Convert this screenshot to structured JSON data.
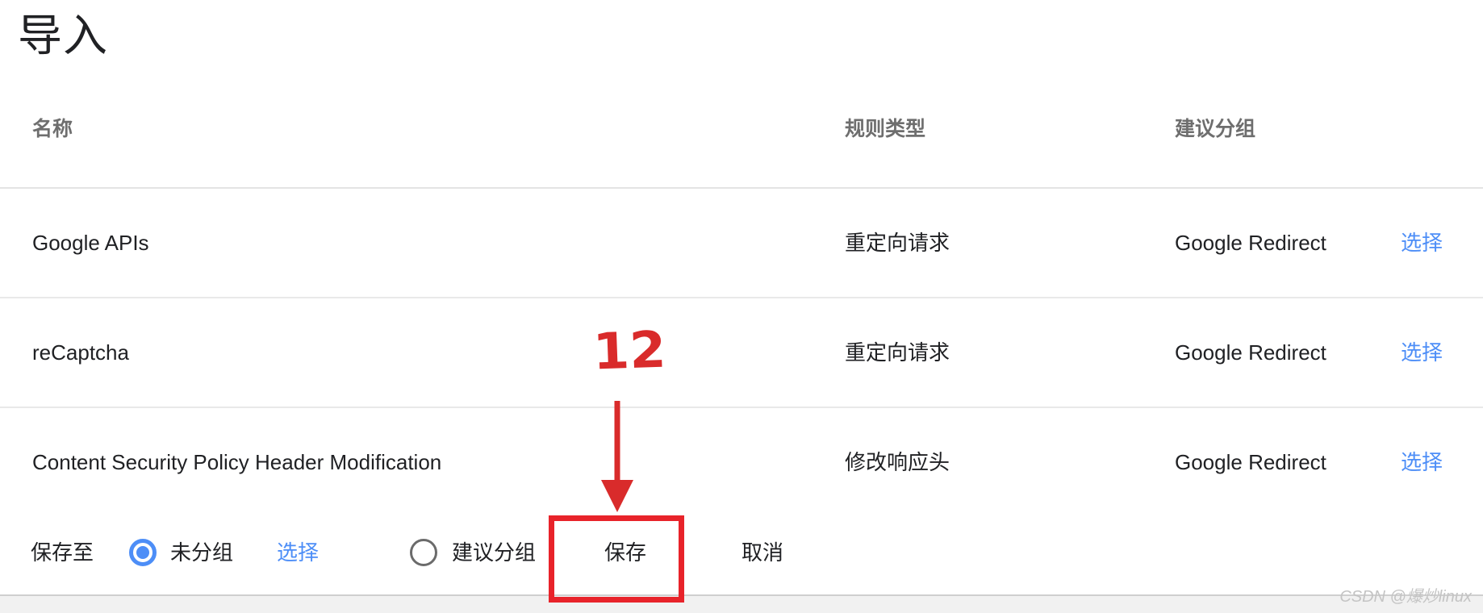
{
  "page": {
    "title": "导入"
  },
  "table": {
    "columns": {
      "name": "名称",
      "rule_type": "规则类型",
      "suggested_group": "建议分组"
    },
    "action_label": "选择",
    "rows": [
      {
        "name": "Google APIs",
        "rule_type": "重定向请求",
        "suggested_group": "Google Redirect",
        "action": "选择"
      },
      {
        "name": "reCaptcha",
        "rule_type": "重定向请求",
        "suggested_group": "Google Redirect",
        "action": "选择"
      },
      {
        "name": "Content Security Policy Header Modification",
        "rule_type": "修改响应头",
        "suggested_group": "Google Redirect",
        "action": "选择"
      }
    ]
  },
  "footer": {
    "save_to_label": "保存至",
    "ungrouped_label": "未分组",
    "select_link": "选择",
    "suggested_group_label": "建议分组",
    "save_button": "保存",
    "cancel_button": "取消",
    "ungrouped_selected": true,
    "suggested_selected": false
  },
  "annotation": {
    "step_number": "12",
    "highlight_color": "#e8232a",
    "arrow_direction": "down",
    "target": "保存"
  },
  "watermark": {
    "text": "CSDN @爆炒linux"
  },
  "colors": {
    "link_blue": "#4d8ef7",
    "text_primary": "#202124",
    "text_muted": "#6e6e6e",
    "divider": "#e9e9e9",
    "annotation_red": "#e8232a"
  }
}
